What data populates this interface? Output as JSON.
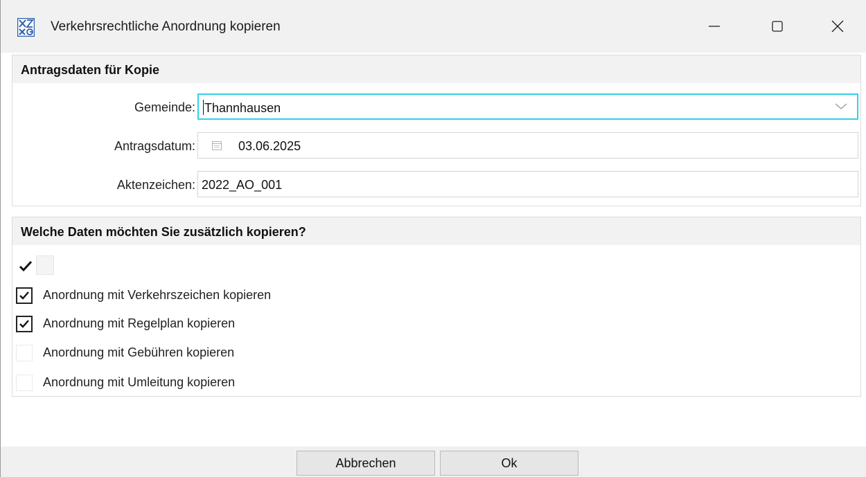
{
  "window": {
    "title": "Verkehrsrechtliche Anordnung kopieren",
    "icon": "app-logo-icon"
  },
  "section1": {
    "title": "Antragsdaten für Kopie",
    "fields": {
      "gemeinde": {
        "label": "Gemeinde:",
        "value": "Thannhausen"
      },
      "antragsdatum": {
        "label": "Antragsdatum:",
        "value": "03.06.2025"
      },
      "aktenzeichen": {
        "label": "Aktenzeichen:",
        "value": "2022_AO_001"
      }
    }
  },
  "section2": {
    "title": "Welche Daten möchten Sie zusätzlich kopieren?",
    "select_all_checked": true,
    "options": [
      {
        "label": "Anordnung mit Verkehrszeichen kopieren",
        "checked": true
      },
      {
        "label": "Anordnung mit Regelplan kopieren",
        "checked": true
      },
      {
        "label": "Anordnung mit Gebühren kopieren",
        "checked": false
      },
      {
        "label": "Anordnung mit Umleitung kopieren",
        "checked": false
      }
    ]
  },
  "footer": {
    "cancel_label": "Abbrechen",
    "ok_label": "Ok"
  },
  "colors": {
    "focus_border": "#33d0e6",
    "titlebar_bg": "#f1f1f1",
    "section_header_bg": "#f2f2f2"
  }
}
